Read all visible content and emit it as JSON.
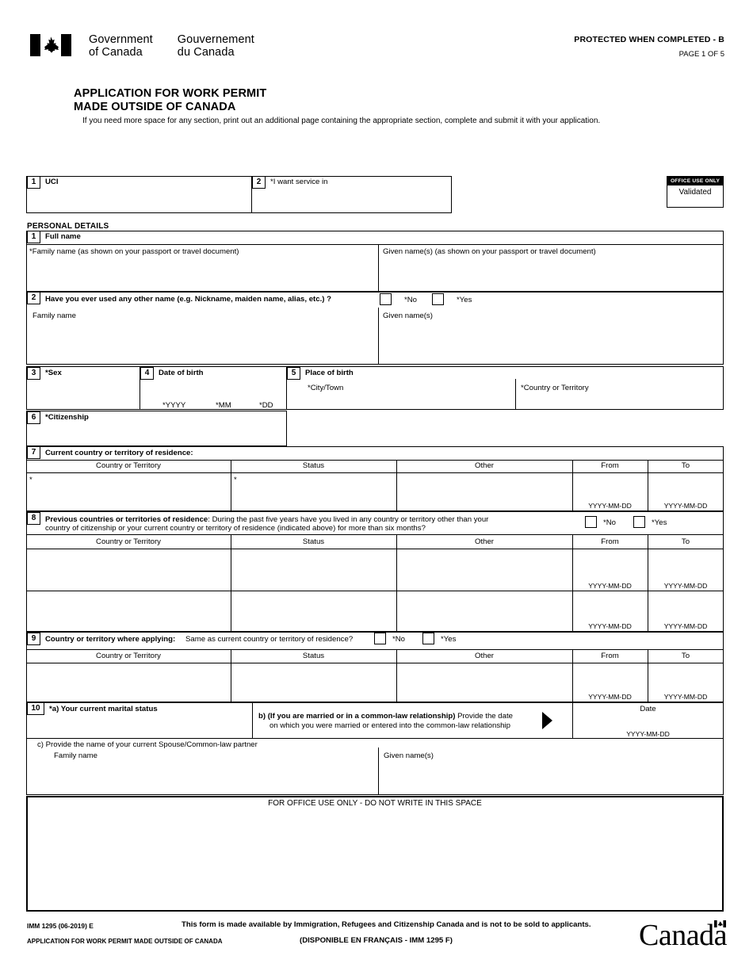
{
  "header": {
    "wordmark_en_line1": "Government",
    "wordmark_en_line2": "of Canada",
    "wordmark_fr_line1": "Gouvernement",
    "wordmark_fr_line2": "du Canada",
    "protected": "PROTECTED WHEN COMPLETED - B",
    "page_of": "PAGE 1 OF 5",
    "title_line1": "APPLICATION FOR WORK PERMIT",
    "title_line2": "MADE OUTSIDE OF CANADA",
    "subtitle": "If you need more space for any section, print out an additional page containing the appropriate section, complete and submit it with your application."
  },
  "office_use": {
    "bar_label": "OFFICE USE ONLY",
    "value": "Validated"
  },
  "top_fields": {
    "uci": {
      "num": "1",
      "label": "UCI",
      "value": ""
    },
    "service_in": {
      "num": "2",
      "label": "*I want service in",
      "value": ""
    }
  },
  "personal_details": {
    "section_heading": "PERSONAL DETAILS",
    "q1": {
      "num": "1",
      "title": "Full name",
      "family_label": "*Family name (as shown on your passport or travel document)",
      "family_value": "",
      "given_label": "Given name(s) (as shown on your passport or travel document)",
      "given_value": ""
    },
    "q2": {
      "num": "2",
      "question": "Have you ever used any other name (e.g. Nickname, maiden name, alias, etc.) ?",
      "no_label": "*No",
      "yes_label": "*Yes",
      "family_label": "Family name",
      "family_value": "",
      "given_label": "Given name(s)",
      "given_value": ""
    },
    "q3": {
      "num": "3",
      "label": "*Sex",
      "value": ""
    },
    "q4": {
      "num": "4",
      "label": "Date of birth",
      "yyyy": "*YYYY",
      "mm": "*MM",
      "dd": "*DD",
      "value": ""
    },
    "q5": {
      "num": "5",
      "label": "Place of birth",
      "city_label": "*City/Town",
      "city_value": "",
      "country_label": "*Country or Territory",
      "country_value": ""
    },
    "q6": {
      "num": "6",
      "label": "*Citizenship",
      "value": ""
    },
    "q7": {
      "num": "7",
      "label": "Current country or territory of residence:",
      "columns": [
        "Country or Territory",
        "Status",
        "Other",
        "From",
        "To"
      ],
      "date_hint": "YYYY-MM-DD",
      "rows": [
        {
          "country": "*",
          "status": "*",
          "other": "",
          "from": "",
          "to": ""
        }
      ]
    },
    "q8": {
      "num": "8",
      "label_bold": "Previous countries or territories of residence",
      "label_rest_line1": ": During the past five years have you lived in any country or territory other than your",
      "label_line2": "country of citizenship or your current country or territory of residence (indicated above) for more than six months?",
      "no_label": "*No",
      "yes_label": "*Yes",
      "columns": [
        "Country or Territory",
        "Status",
        "Other",
        "From",
        "To"
      ],
      "date_hint": "YYYY-MM-DD",
      "rows": [
        {
          "country": "",
          "status": "",
          "other": "",
          "from": "",
          "to": ""
        },
        {
          "country": "",
          "status": "",
          "other": "",
          "from": "",
          "to": ""
        }
      ]
    },
    "q9": {
      "num": "9",
      "label_bold": "Country or territory where applying:",
      "question": "Same as current country or territory of residence?",
      "no_label": "*No",
      "yes_label": "*Yes",
      "columns": [
        "Country or Territory",
        "Status",
        "Other",
        "From",
        "To"
      ],
      "date_hint": "YYYY-MM-DD",
      "rows": [
        {
          "country": "",
          "status": "",
          "other": "",
          "from": "",
          "to": ""
        }
      ]
    },
    "q10": {
      "num": "10",
      "a_label": "*a) Your current marital status",
      "a_value": "",
      "b_bold_1": "b) (If you are married or in a common-law relationship)",
      "b_rest_1": " Provide the date",
      "b_line2": "on which you were married or entered into the common-law relationship",
      "date_header": "Date",
      "date_hint": "YYYY-MM-DD",
      "date_value": "",
      "c_label": "c) Provide the name of your current Spouse/Common-law partner",
      "family_label": "Family name",
      "family_value": "",
      "given_label": "Given name(s)",
      "given_value": ""
    }
  },
  "office_block": {
    "label": "FOR OFFICE USE ONLY - DO NOT WRITE IN THIS SPACE"
  },
  "footer": {
    "form_code": "IMM 1295 (06-2019) E",
    "form_title": "APPLICATION FOR WORK PERMIT MADE OUTSIDE OF CANADA",
    "availability": "This form is made available by Immigration, Refugees and Citizenship Canada and is not to be sold to applicants.",
    "french_note": "(DISPONIBLE EN FRANÇAIS - IMM 1295 F)",
    "canada_wordmark": "Canada"
  }
}
